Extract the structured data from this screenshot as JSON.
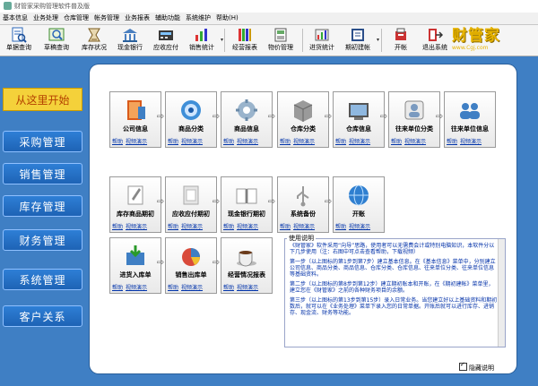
{
  "window": {
    "title": "财管家采购管理软件普及版"
  },
  "menu": [
    "基本信息",
    "业务处理",
    "仓库管理",
    "帐务管理",
    "业务报表",
    "辅助功能",
    "系统维护",
    "帮助(H)"
  ],
  "toolbar": [
    {
      "label": "单据查询",
      "icon": "document-search-icon"
    },
    {
      "label": "草稿查询",
      "icon": "draft-search-icon"
    },
    {
      "label": "库存状况",
      "icon": "inventory-icon"
    },
    {
      "label": "现金银行",
      "icon": "bank-icon"
    },
    {
      "label": "应收应付",
      "icon": "receivable-payable-icon"
    },
    {
      "label": "销售统计",
      "icon": "sales-chart-icon"
    },
    {
      "label": "经营报表",
      "icon": "report-icon"
    },
    {
      "label": "物价管理",
      "icon": "price-tag-icon"
    },
    {
      "label": "进货统计",
      "icon": "purchase-stats-icon"
    },
    {
      "label": "期初建帐",
      "icon": "ledger-icon"
    },
    {
      "label": "开帐",
      "icon": "open-ledger-icon"
    },
    {
      "label": "退出系统",
      "icon": "exit-icon"
    }
  ],
  "brand": {
    "name": "财管家",
    "url": "www.Cgj.com"
  },
  "left_nav": {
    "start": "从这里开始",
    "items": [
      "采购管理",
      "销售管理",
      "库存管理",
      "财务管理",
      "系统管理",
      "客户关系"
    ]
  },
  "links": {
    "help": "帮助",
    "video": "视频演示"
  },
  "cards": [
    {
      "label": "公司信息",
      "icon": "company-book-icon"
    },
    {
      "label": "商品分类",
      "icon": "product-category-icon"
    },
    {
      "label": "商品信息",
      "icon": "product-gear-icon"
    },
    {
      "label": "仓库分类",
      "icon": "warehouse-category-icon"
    },
    {
      "label": "仓库信息",
      "icon": "warehouse-info-icon"
    },
    {
      "label": "往来单位分类",
      "icon": "partner-category-icon"
    },
    {
      "label": "往来单位信息",
      "icon": "partner-info-icon"
    },
    {
      "label": "库存商品期初",
      "icon": "stock-opening-icon"
    },
    {
      "label": "应收应付期初",
      "icon": "ar-ap-opening-icon"
    },
    {
      "label": "现金银行期初",
      "icon": "cash-bank-opening-icon"
    },
    {
      "label": "系统备份",
      "icon": "backup-usb-icon"
    },
    {
      "label": "开账",
      "icon": "globe-icon"
    },
    {
      "label": "进货入库单",
      "icon": "purchase-in-icon"
    },
    {
      "label": "销售出库单",
      "icon": "sales-out-icon"
    },
    {
      "label": "经营情况报表",
      "icon": "coffee-report-icon"
    }
  ],
  "description": {
    "title": "使用说明",
    "paragraphs": [
      "《财管家》软件采用“向导”思路，使用者可以无需费会计或特别电脑知识，本软件分以下几步使用（注：右图中可点击查看帮助，下载视频）",
      "第一步（以上图标的第1步到第7步）建立基本信息。在《基本信息》菜单中，分别建立公司信息、商品分类、商品信息、仓库分类、仓库信息、往来单位分类、往来单位信息等基础资料。",
      "第二步（以上图标的第8步到第12步）建立期初账本和开账，在《期初建帐》菜单里，建立您在《财管家》之前的各种财务项目的余额。",
      "第三步（以上图标的第13步到第15步）录入日常业务。当您建立好以上基础资料和期初数后，就可以在《业务处理》菜单下录入您的日常单据。开账后就可以进行库存、进销存、现金流、财务等功能。"
    ]
  },
  "hide_desc": {
    "label": "隐藏说明",
    "checked": true
  }
}
